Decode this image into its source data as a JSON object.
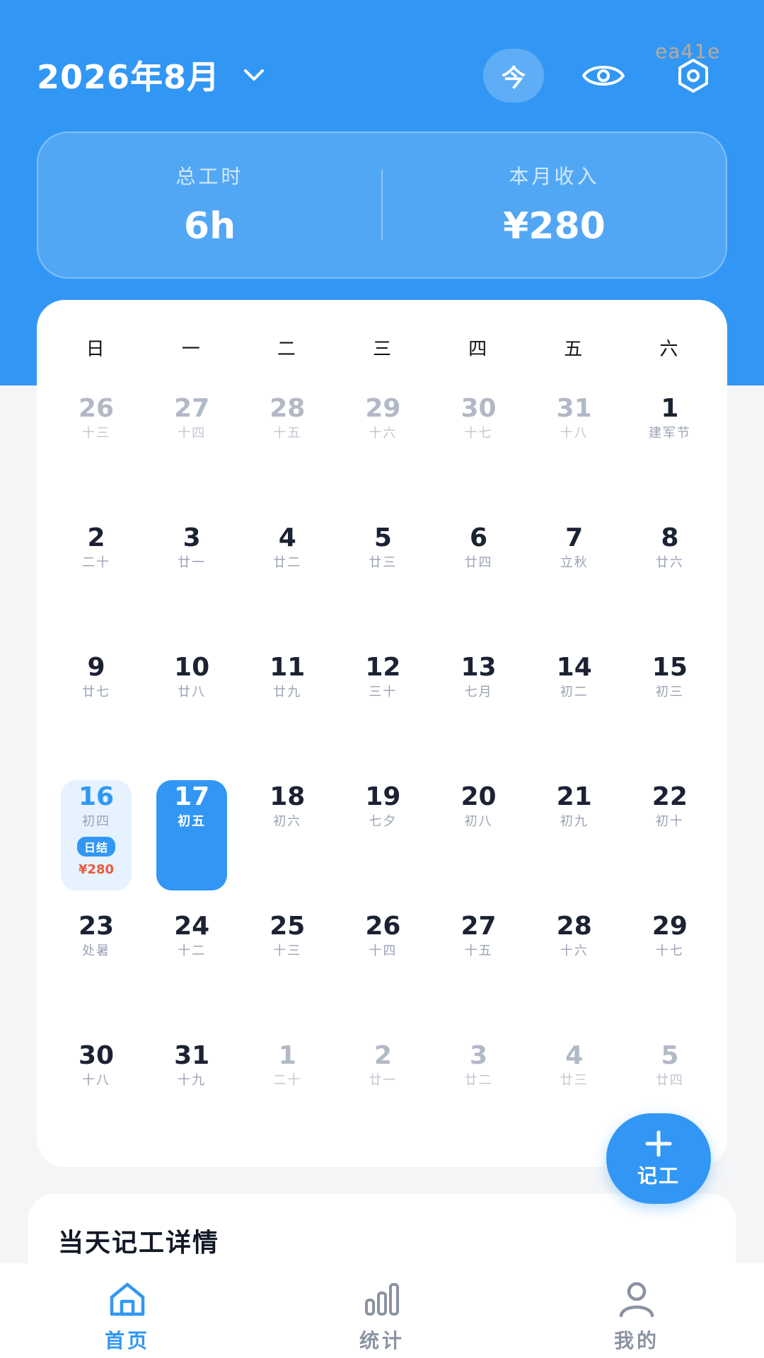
{
  "watermark": "ea41e",
  "header": {
    "month_title": "2026年8月",
    "today_label": "今",
    "icons": [
      "chevron-down-icon",
      "eye-icon",
      "settings-hexagon-icon"
    ]
  },
  "summary": {
    "hours_label": "总工时",
    "hours_value": "6h",
    "income_label": "本月收入",
    "income_value": "¥280"
  },
  "calendar": {
    "weekdays": [
      "日",
      "一",
      "二",
      "三",
      "四",
      "五",
      "六"
    ],
    "days": [
      {
        "day": "26",
        "lunar": "十三",
        "other": true
      },
      {
        "day": "27",
        "lunar": "十四",
        "other": true
      },
      {
        "day": "28",
        "lunar": "十五",
        "other": true
      },
      {
        "day": "29",
        "lunar": "十六",
        "other": true
      },
      {
        "day": "30",
        "lunar": "十七",
        "other": true
      },
      {
        "day": "31",
        "lunar": "十八",
        "other": true
      },
      {
        "day": "1",
        "lunar": "建军节"
      },
      {
        "day": "2",
        "lunar": "二十"
      },
      {
        "day": "3",
        "lunar": "廿一"
      },
      {
        "day": "4",
        "lunar": "廿二"
      },
      {
        "day": "5",
        "lunar": "廿三"
      },
      {
        "day": "6",
        "lunar": "廿四"
      },
      {
        "day": "7",
        "lunar": "立秋"
      },
      {
        "day": "8",
        "lunar": "廿六"
      },
      {
        "day": "9",
        "lunar": "廿七"
      },
      {
        "day": "10",
        "lunar": "廿八"
      },
      {
        "day": "11",
        "lunar": "廿九"
      },
      {
        "day": "12",
        "lunar": "三十"
      },
      {
        "day": "13",
        "lunar": "七月"
      },
      {
        "day": "14",
        "lunar": "初二"
      },
      {
        "day": "15",
        "lunar": "初三"
      },
      {
        "day": "16",
        "lunar": "初四",
        "recorded": true,
        "badge": "日结",
        "amount": "¥280"
      },
      {
        "day": "17",
        "lunar": "初五",
        "selected": true
      },
      {
        "day": "18",
        "lunar": "初六"
      },
      {
        "day": "19",
        "lunar": "七夕"
      },
      {
        "day": "20",
        "lunar": "初八"
      },
      {
        "day": "21",
        "lunar": "初九"
      },
      {
        "day": "22",
        "lunar": "初十"
      },
      {
        "day": "23",
        "lunar": "处暑"
      },
      {
        "day": "24",
        "lunar": "十二"
      },
      {
        "day": "25",
        "lunar": "十三"
      },
      {
        "day": "26",
        "lunar": "十四"
      },
      {
        "day": "27",
        "lunar": "十五"
      },
      {
        "day": "28",
        "lunar": "十六"
      },
      {
        "day": "29",
        "lunar": "十七"
      },
      {
        "day": "30",
        "lunar": "十八"
      },
      {
        "day": "31",
        "lunar": "十九"
      },
      {
        "day": "1",
        "lunar": "二十",
        "other": true
      },
      {
        "day": "2",
        "lunar": "廿一",
        "other": true
      },
      {
        "day": "3",
        "lunar": "廿二",
        "other": true
      },
      {
        "day": "4",
        "lunar": "廿三",
        "other": true
      },
      {
        "day": "5",
        "lunar": "廿四",
        "other": true
      }
    ]
  },
  "fab": {
    "label": "记工",
    "icon": "plus-icon"
  },
  "detail": {
    "title": "当天记工详情"
  },
  "nav": [
    {
      "label": "首页",
      "icon": "home-icon",
      "active": true
    },
    {
      "label": "统计",
      "icon": "bar-chart-icon",
      "active": false
    },
    {
      "label": "我的",
      "icon": "user-icon",
      "active": false
    }
  ],
  "colors": {
    "primary": "#3297f4",
    "recorded_bg": "#e6f2fd",
    "amount": "#ea5a3c",
    "muted": "#9aa3b4"
  }
}
